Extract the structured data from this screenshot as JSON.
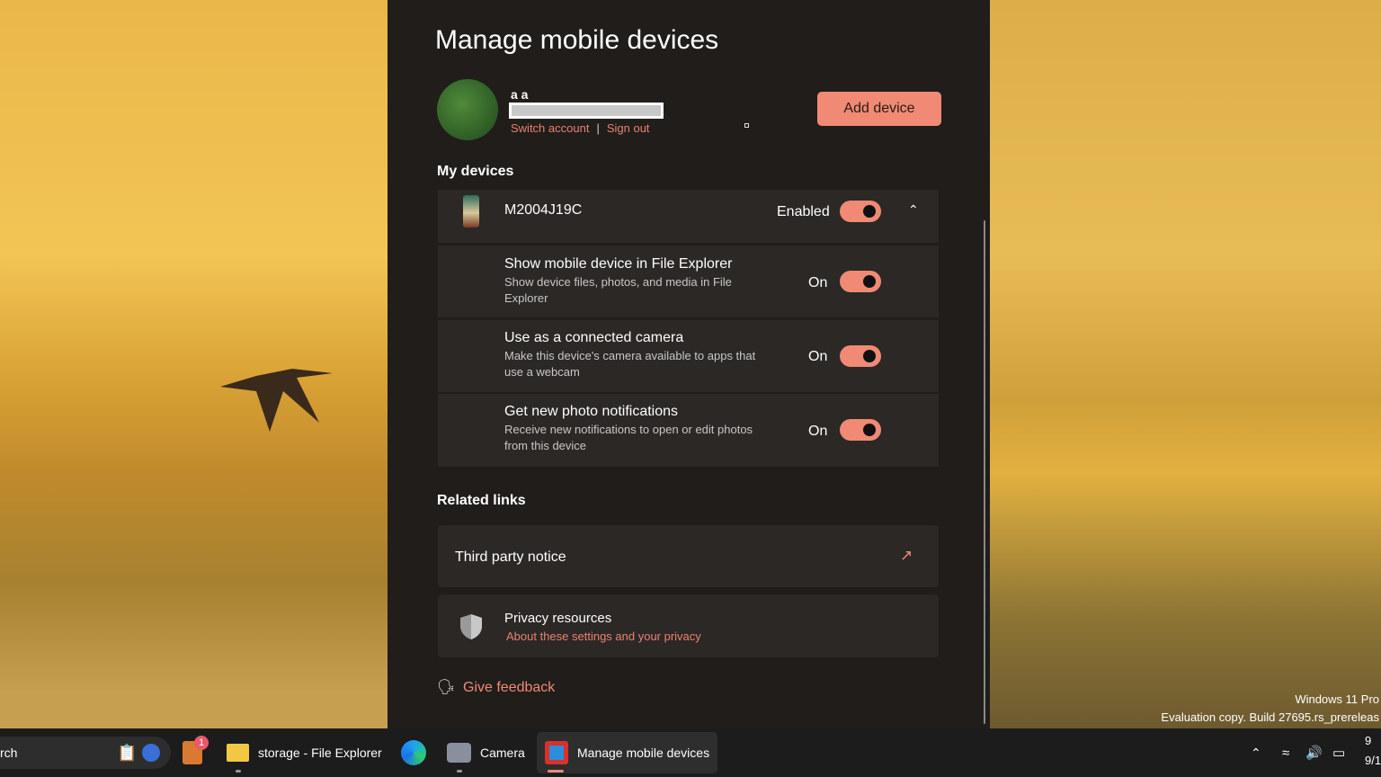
{
  "page": {
    "title": "Manage mobile devices"
  },
  "account": {
    "name": "a a",
    "switch_account": "Switch account",
    "separator": "|",
    "sign_out": "Sign out",
    "add_device": "Add device"
  },
  "my_devices": {
    "heading": "My devices",
    "device": {
      "name": "M2004J19C",
      "status": "Enabled",
      "enabled": true
    },
    "settings": [
      {
        "title": "Show mobile device in File Explorer",
        "description": "Show device files, photos, and media in File Explorer",
        "state": "On"
      },
      {
        "title": "Use as a connected camera",
        "description": "Make this device's camera available to apps that use a webcam",
        "state": "On"
      },
      {
        "title": "Get new photo notifications",
        "description": "Receive new notifications to open or edit photos from this device",
        "state": "On"
      }
    ]
  },
  "related_links": {
    "heading": "Related links",
    "third_party": "Third party notice",
    "privacy_title": "Privacy resources",
    "privacy_link": "About these settings and your privacy"
  },
  "feedback": "Give feedback",
  "watermark": {
    "line1": "Windows 11 Pro",
    "line2": "Evaluation copy. Build 27695.rs_prereleas"
  },
  "taskbar": {
    "search": "rch",
    "badge": "1",
    "apps": [
      {
        "label": "storage - File Explorer"
      },
      {
        "label": "Camera"
      },
      {
        "label": "Manage mobile devices"
      }
    ],
    "clock_line1": "9",
    "clock_line2": "9/1"
  },
  "colors": {
    "accent": "#f08a74",
    "panel": "#201d1b",
    "card": "#2b2826"
  }
}
